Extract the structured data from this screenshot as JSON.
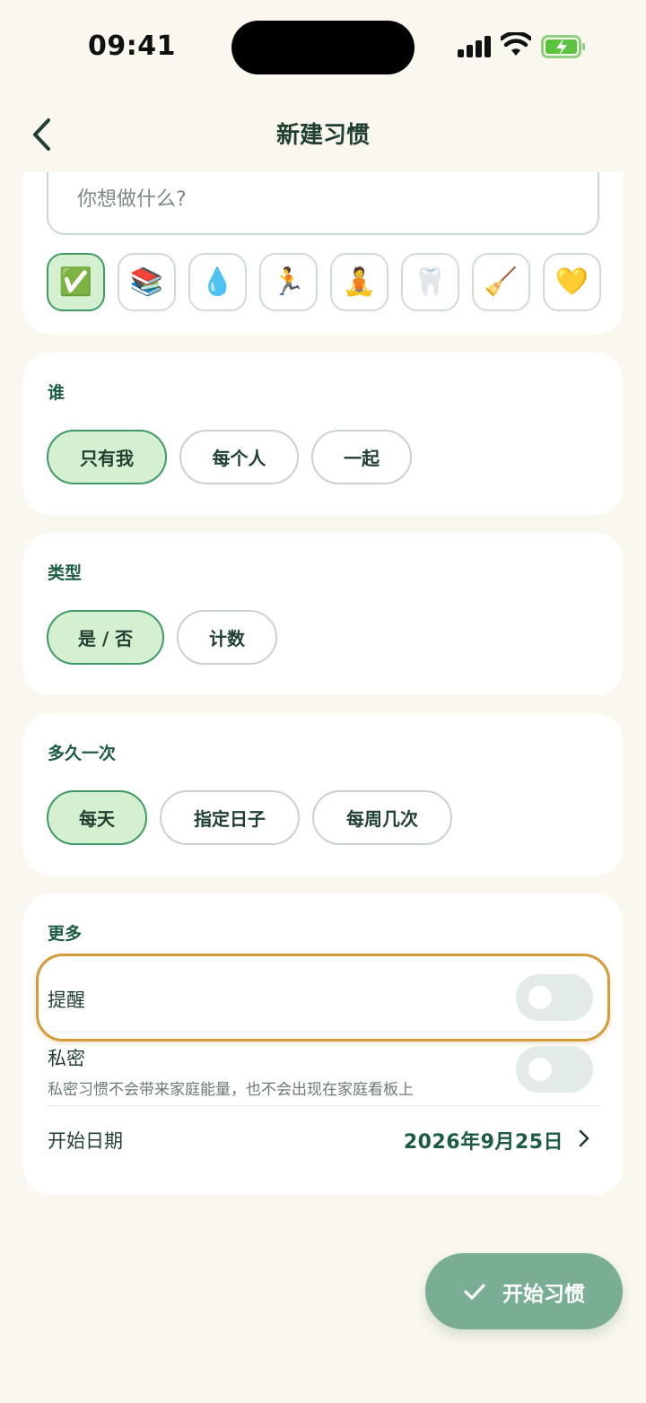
{
  "status": {
    "time": "09:41"
  },
  "nav": {
    "title": "新建习惯"
  },
  "name_field": {
    "placeholder": "你想做什么?"
  },
  "emojis": [
    {
      "char": "✅",
      "selected": true
    },
    {
      "char": "📚",
      "selected": false
    },
    {
      "char": "💧",
      "selected": false
    },
    {
      "char": "🏃",
      "selected": false
    },
    {
      "char": "🧘",
      "selected": false
    },
    {
      "char": "🦷",
      "selected": false
    },
    {
      "char": "🧹",
      "selected": false
    },
    {
      "char": "💛",
      "selected": false
    }
  ],
  "who": {
    "label": "谁",
    "options": [
      "只有我",
      "每个人",
      "一起"
    ]
  },
  "type": {
    "label": "类型",
    "options": [
      "是 / 否",
      "计数"
    ]
  },
  "frequency": {
    "label": "多久一次",
    "options": [
      "每天",
      "指定日子",
      "每周几次"
    ]
  },
  "more": {
    "label": "更多",
    "reminder_label": "提醒",
    "private_label": "私密",
    "private_desc": "私密习惯不会带来家庭能量，也不会出现在家庭看板上",
    "start_date_label": "开始日期",
    "start_date_value": "2026年9月25日"
  },
  "fab": {
    "label": "开始习惯"
  },
  "colors": {
    "accent": "#1d5c40",
    "selected_bg": "#d4f0d0",
    "fab_bg": "#79ae95",
    "highlight": "#d39b3a"
  }
}
